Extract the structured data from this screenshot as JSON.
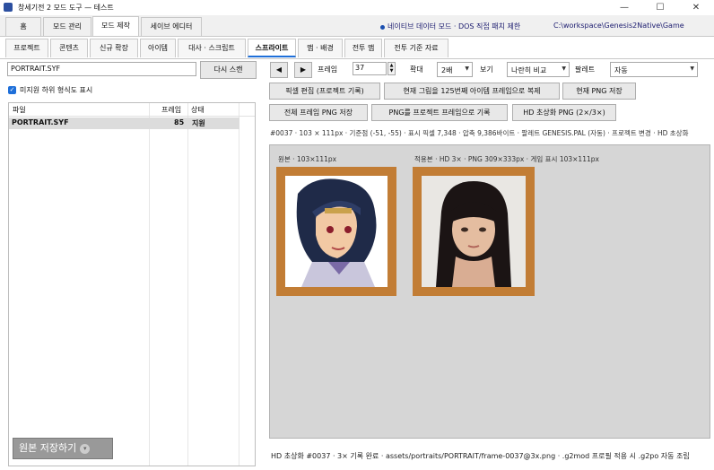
{
  "window": {
    "title": "창세기전 2 모드 도구 — 테스트",
    "minimize": "—",
    "maximize": "☐",
    "close": "✕"
  },
  "main_tabs": [
    {
      "label": "홈"
    },
    {
      "label": "모드 관리"
    },
    {
      "label": "모드 제작",
      "active": true
    },
    {
      "label": "세이브 에디터"
    }
  ],
  "header": {
    "native_note": "네이티브 데이터 모드 · DOS 직접 패치 제한",
    "workspace_path": "C:\\workspace\\Genesis2Native\\Game"
  },
  "sub_tabs": [
    {
      "label": "프로젝트"
    },
    {
      "label": "콘텐츠"
    },
    {
      "label": "신규 확장"
    },
    {
      "label": "아이템"
    },
    {
      "label": "대사 · 스크립트"
    },
    {
      "label": "스프라이트",
      "active": true
    },
    {
      "label": "맵 · 배경"
    },
    {
      "label": "전투 맵"
    },
    {
      "label": "전투 기준 자료"
    }
  ],
  "left": {
    "file_input_value": "PORTRAIT.SYF",
    "rescan_label": "다시 스캔",
    "show_subformats_label": "미지원 하위 형식도 표시",
    "show_subformats_checked": true,
    "columns": [
      "파일",
      "프레임",
      "상태"
    ],
    "files": [
      {
        "name": "PORTRAIT.SYF",
        "frames": "85",
        "status": "지원"
      }
    ],
    "save_original_label": "원본 저장하기",
    "save_dropdown_icon": "▾"
  },
  "toolbar": {
    "prev_icon": "◀",
    "next_icon": "▶",
    "frame_label": "프레임",
    "frame_value": "37",
    "zoom_label": "확대",
    "zoom_value": "2배",
    "view_label": "보기",
    "view_value": "나란히 비교",
    "palette_label": "팔레트",
    "palette_value": "자동"
  },
  "actions": {
    "pixel_edit": "픽셀 편집 (프로젝트 기록)",
    "copy_to_125": "현재 그림을 125번째 아이템 프레임으로 복제",
    "save_current_png": "현재 PNG 저장",
    "save_all_png": "전체 프레임 PNG 저장",
    "record_png": "PNG를 프로젝트 프레임으로 기록",
    "hd_portrait_png": "HD 초상화 PNG (2×/3×)"
  },
  "info_line": "#0037 · 103 × 111px · 기준점 (-51, -55) · 표시 픽셀 7,348 · 압축 9,386바이트 · 팔레트 GENESIS.PAL (자동) · 프로젝트 변경 · HD 초상화",
  "preview": {
    "original_caption": "원본 · 103×111px",
    "applied_caption": "적용본 · HD 3× · PNG 309×333px · 게임 표시 103×111px"
  },
  "status": "HD 초상화 #0037 · 3× 기록 완료 · assets/portraits/PORTRAIT/frame-0037@3x.png · .g2mod 프로필 적용 시 .g2po 자동 조립",
  "colors": {
    "accent": "#1e6fd9",
    "frame_gold": "#c27d35",
    "preview_bg": "#d6d6d6"
  }
}
